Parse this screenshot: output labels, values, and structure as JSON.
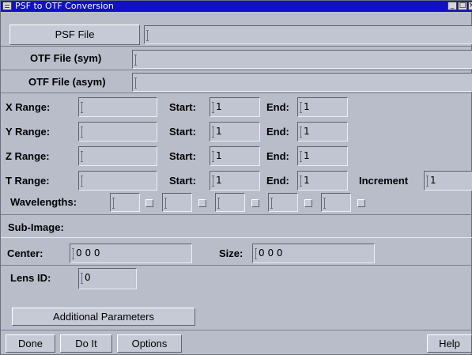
{
  "window": {
    "title": "PSF to OTF Conversion"
  },
  "files": {
    "psf_button": "PSF File",
    "psf_value": "",
    "otf_sym_label": "OTF File (sym)",
    "otf_sym_value": "",
    "otf_asym_label": "OTF File (asym)",
    "otf_asym_value": ""
  },
  "ranges": [
    {
      "label": "X Range:",
      "value": "",
      "start_label": "Start:",
      "start": "1",
      "end_label": "End:",
      "end": "1"
    },
    {
      "label": "Y Range:",
      "value": "",
      "start_label": "Start:",
      "start": "1",
      "end_label": "End:",
      "end": "1"
    },
    {
      "label": "Z Range:",
      "value": "",
      "start_label": "Start:",
      "start": "1",
      "end_label": "End:",
      "end": "1"
    },
    {
      "label": "T Range:",
      "value": "",
      "start_label": "Start:",
      "start": "1",
      "end_label": "End:",
      "end": "1",
      "increment_label": "Increment",
      "increment": "1"
    }
  ],
  "wavelengths": {
    "label": "Wavelengths:",
    "values": [
      "",
      "",
      "",
      "",
      ""
    ]
  },
  "subimage": {
    "label": "Sub-Image:",
    "center_label": "Center:",
    "center": "0 0 0",
    "size_label": "Size:",
    "size": "0 0 0"
  },
  "lens": {
    "label": "Lens ID:",
    "value": "0"
  },
  "additional_button": "Additional Parameters",
  "footer": {
    "done": "Done",
    "doit": "Do It",
    "options": "Options",
    "help": "Help"
  }
}
